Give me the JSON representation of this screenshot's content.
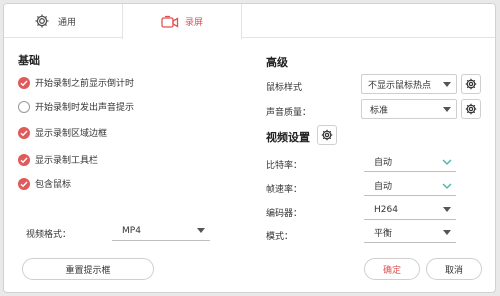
{
  "tabs": {
    "general": "通用",
    "record": "录屏"
  },
  "basic": {
    "heading": "基础",
    "options": [
      {
        "label": "开始录制之前显示倒计时",
        "checked": true
      },
      {
        "label": "开始录制时发出声音提示",
        "checked": false
      },
      {
        "label": "显示录制区域边框",
        "checked": true
      },
      {
        "label": "显示录制工具栏",
        "checked": true
      },
      {
        "label": "包含鼠标",
        "checked": true
      }
    ],
    "video_format_label": "视频格式：",
    "video_format_value": "MP4"
  },
  "advanced": {
    "heading": "高级",
    "mouse_style_label": "鼠标样式",
    "mouse_style_value": "不显示鼠标热点",
    "audio_quality_label": "声音质量：",
    "audio_quality_value": "标准"
  },
  "video_settings": {
    "heading": "视频设置",
    "bitrate_label": "比特率：",
    "bitrate_value": "自动",
    "framerate_label": "帧速率：",
    "framerate_value": "自动",
    "encoder_label": "编码器：",
    "encoder_value": "H264",
    "mode_label": "模式：",
    "mode_value": "平衡"
  },
  "buttons": {
    "reset": "重置提示框",
    "ok": "确定",
    "cancel": "取消"
  },
  "colors": {
    "accent": "#e05252",
    "checkbox_on": "#e05a5a",
    "teal_arrow": "#46b3a6"
  }
}
